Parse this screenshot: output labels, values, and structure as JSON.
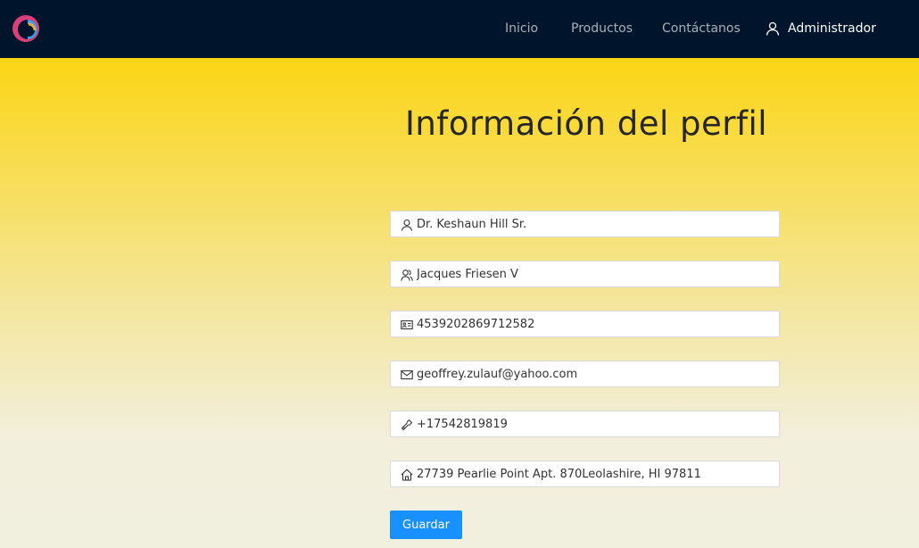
{
  "navbar": {
    "logo_icon": "swirl-logo-icon",
    "links": [
      "Inicio",
      "Productos",
      "Contáctanos"
    ],
    "user": {
      "icon": "user-icon",
      "label": "Administrador"
    }
  },
  "profile": {
    "title": "Información del perfil",
    "fields": [
      {
        "icon": "user-icon",
        "value": "Dr. Keshaun Hill Sr."
      },
      {
        "icon": "users-icon",
        "value": "Jacques Friesen V"
      },
      {
        "icon": "id-card-icon",
        "value": "4539202869712582"
      },
      {
        "icon": "mail-icon",
        "value": "geoffrey.zulauf@yahoo.com"
      },
      {
        "icon": "phone-icon",
        "value": "+17542819819"
      },
      {
        "icon": "home-icon",
        "value": "27739 Pearlie Point Apt. 870Leolashire, HI 97811"
      }
    ],
    "save_label": "Guardar"
  },
  "colors": {
    "navbar_bg": "#00152b",
    "primary": "#1890ff",
    "gradient_top": "#fbd515",
    "gradient_bottom": "#f2efdd"
  }
}
